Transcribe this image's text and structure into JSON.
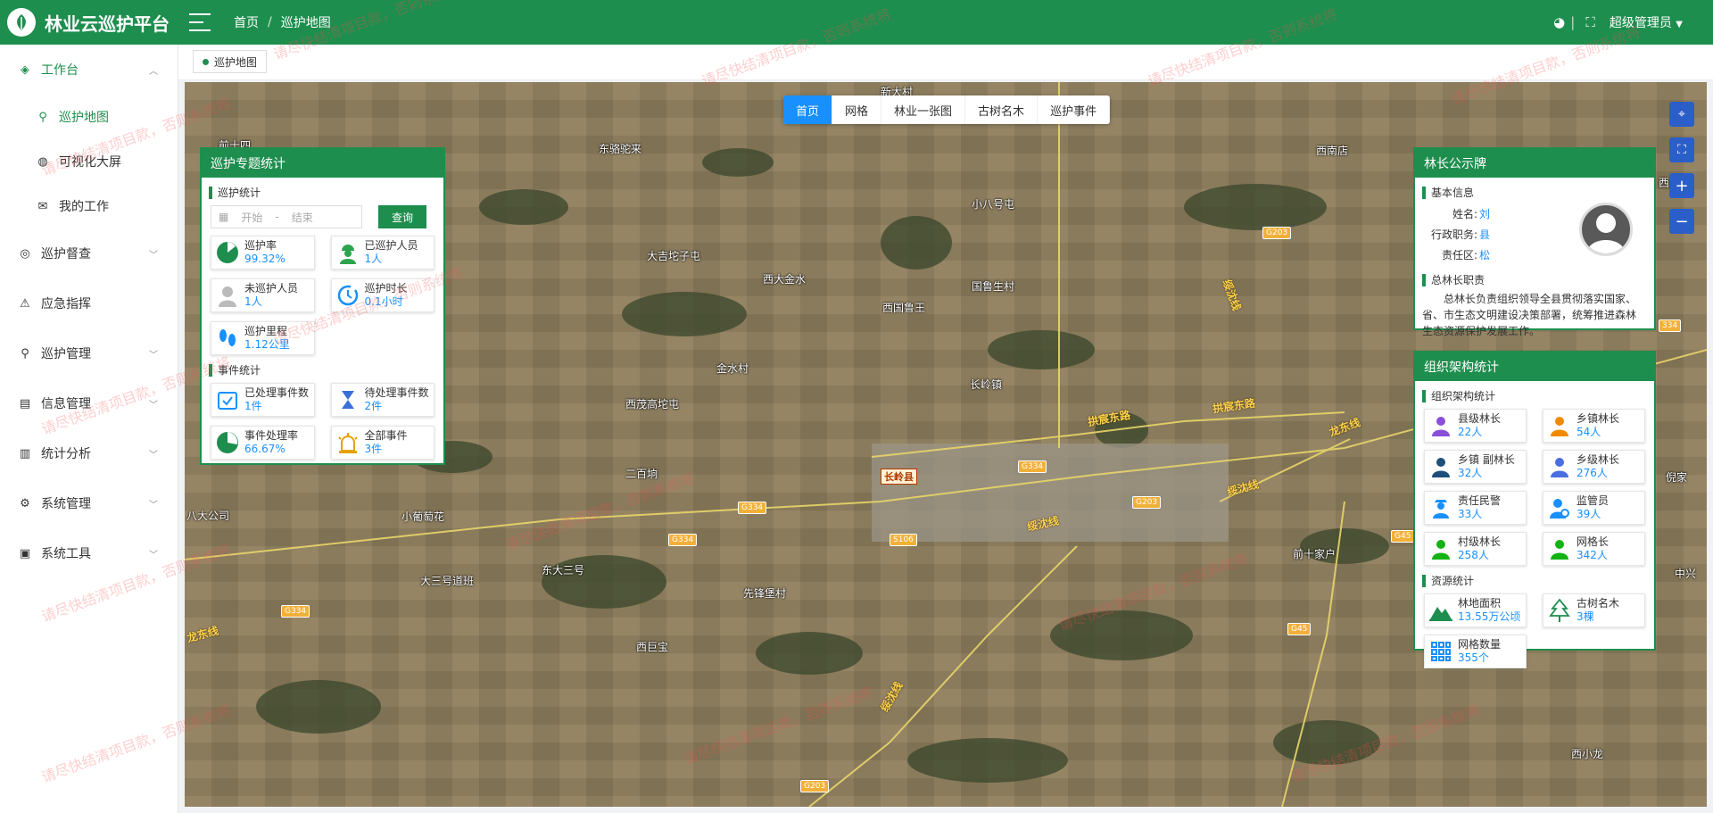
{
  "header": {
    "app_title": "林业云巡护平台",
    "breadcrumb": [
      "首页",
      "巡护地图"
    ],
    "breadcrumb_sep": "/",
    "user": "超级管理员"
  },
  "sidebar": {
    "items": [
      {
        "label": "工作台",
        "icon": "desktop-icon",
        "expanded": true
      },
      {
        "label": "巡护督查",
        "icon": "target-icon"
      },
      {
        "label": "应急指挥",
        "icon": "alert-icon"
      },
      {
        "label": "巡护管理",
        "icon": "person-pin-icon"
      },
      {
        "label": "信息管理",
        "icon": "info-card-icon"
      },
      {
        "label": "统计分析",
        "icon": "bar-chart-icon"
      },
      {
        "label": "系统管理",
        "icon": "gear-icon"
      },
      {
        "label": "系统工具",
        "icon": "toolbox-icon"
      }
    ],
    "sub_items": [
      {
        "label": "巡护地图",
        "icon": "map-person-icon",
        "current": true
      },
      {
        "label": "可视化大屏",
        "icon": "globe-icon"
      },
      {
        "label": "我的工作",
        "icon": "mail-icon"
      }
    ]
  },
  "tags": {
    "active": "巡护地图"
  },
  "map_tabs": [
    {
      "label": "首页",
      "active": true
    },
    {
      "label": "网格"
    },
    {
      "label": "林业一张图"
    },
    {
      "label": "古树名木"
    },
    {
      "label": "巡护事件"
    }
  ],
  "map_labels": {
    "places": [
      "新大村",
      "东骆驼来",
      "前十四",
      "小八号屯",
      "西南店",
      "大吉坨子屯",
      "西大金水",
      "西国鲁王",
      "国鲁生村",
      "金水村",
      "长岭镇",
      "西茂高坨屯",
      "二百垧",
      "八大公司",
      "小葡萄花",
      "大三号道班",
      "东大三号",
      "先锋堡村",
      "西巨宝",
      "前十家户",
      "倪家",
      "西四",
      "中兴",
      "西小龙"
    ],
    "roads": [
      "拱宸东路",
      "拱宸东路",
      "龙东线",
      "绥沈线",
      "绥沈线",
      "绥沈线",
      "龙东线",
      "绥沈线"
    ],
    "shields": [
      "G203",
      "G203",
      "G203",
      "G334",
      "G334",
      "G334",
      "G334",
      "G45",
      "G45",
      "S106",
      "334"
    ],
    "county": "长岭县"
  },
  "patrol_panel": {
    "title": "巡护专题统计",
    "patrol_section": "巡护统计",
    "date_start_placeholder": "开始",
    "date_sep": "-",
    "date_end_placeholder": "结束",
    "query_button": "查询",
    "patrol_cards": [
      {
        "label": "巡护率",
        "value": "99.32%",
        "icon": "pie-icon"
      },
      {
        "label": "已巡护人员",
        "value": "1人",
        "icon": "worker-icon"
      },
      {
        "label": "未巡护人员",
        "value": "1人",
        "icon": "user-grey-icon"
      },
      {
        "label": "巡护时长",
        "value": "0.1小时",
        "icon": "clock-icon"
      },
      {
        "label": "巡护里程",
        "value": "1.12公里",
        "icon": "footprint-icon"
      }
    ],
    "event_section": "事件统计",
    "event_cards": [
      {
        "label": "已处理事件数",
        "value": "1件",
        "icon": "calendar-check-icon"
      },
      {
        "label": "待处理事件数",
        "value": "2件",
        "icon": "hourglass-icon"
      },
      {
        "label": "事件处理率",
        "value": "66.67%",
        "icon": "pie-icon"
      },
      {
        "label": "全部事件",
        "value": "3件",
        "icon": "siren-icon"
      }
    ]
  },
  "chief_panel": {
    "title": "林长公示牌",
    "basic_section": "基本信息",
    "rows": [
      {
        "key": "姓名:",
        "value": "刘"
      },
      {
        "key": "行政职务:",
        "value": "县"
      },
      {
        "key": "责任区:",
        "value": "松"
      }
    ],
    "duty_section": "总林长职责",
    "duty_text": "总林长负责组织领导全县贯彻落实国家、省、市生态文明建设决策部署，统筹推进森林生态资源保护发展工作。"
  },
  "org_panel": {
    "title": "组织架构统计",
    "org_section": "组织架构统计",
    "org_cards": [
      {
        "label": "县级林长",
        "value": "22人",
        "icon": "purple-person-icon"
      },
      {
        "label": "乡镇林长",
        "value": "54人",
        "icon": "orange-person-icon"
      },
      {
        "label": "乡镇 副林长",
        "value": "32人",
        "icon": "navy-person-icon"
      },
      {
        "label": "乡级林长",
        "value": "276人",
        "icon": "blue-person-icon"
      },
      {
        "label": "责任民警",
        "value": "33人",
        "icon": "police-icon"
      },
      {
        "label": "监管员",
        "value": "39人",
        "icon": "inspector-icon"
      },
      {
        "label": "村级林长",
        "value": "258人",
        "icon": "green-person-icon"
      },
      {
        "label": "网格长",
        "value": "342人",
        "icon": "green-person-icon"
      }
    ],
    "resource_section": "资源统计",
    "resource_cards": [
      {
        "label": "林地面积",
        "value": "13.55万公顷",
        "icon": "mountain-icon"
      },
      {
        "label": "古树名木",
        "value": "3棵",
        "icon": "tree-icon"
      },
      {
        "label": "网格数量",
        "value": "355个",
        "icon": "grid-icon"
      }
    ]
  },
  "watermark": "请尽快结清项目款，否则系统将",
  "colors": {
    "brand": "#1e8e4e",
    "accent": "#1890ff"
  }
}
